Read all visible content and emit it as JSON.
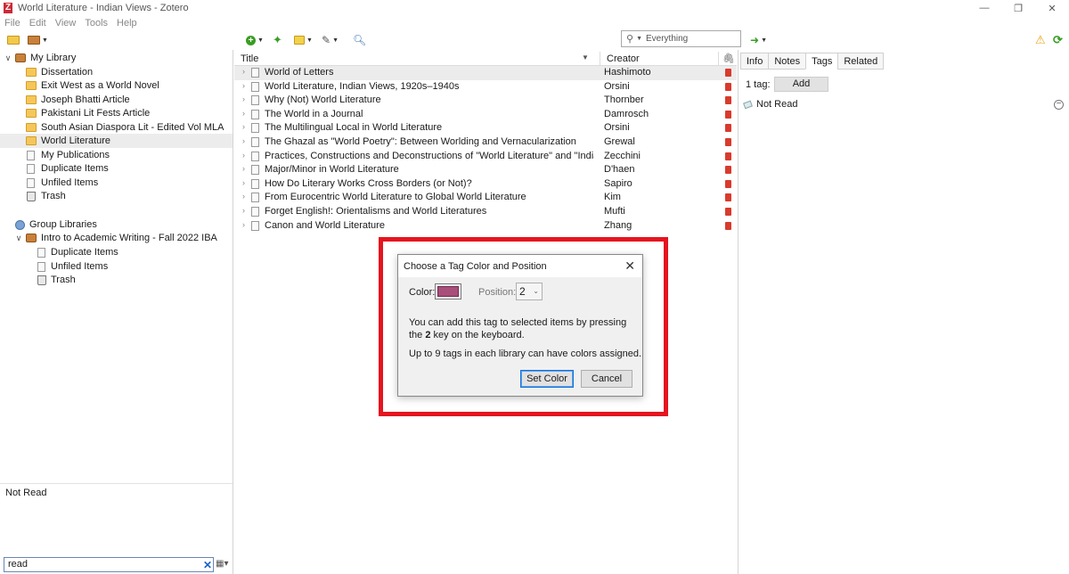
{
  "app": {
    "title": "World Literature - Indian Views - Zotero",
    "logo_letter": "Z"
  },
  "window_controls": {
    "minimize": "—",
    "maximize": "❐",
    "close": "✕"
  },
  "menu": [
    "File",
    "Edit",
    "View",
    "Tools",
    "Help"
  ],
  "toolbar": {
    "search_placeholder": "Everything",
    "warning_icon": "⚠",
    "sync_icon": "⟳",
    "arrow_icon": "➜"
  },
  "collections": {
    "my_library": "My Library",
    "items": [
      "Dissertation",
      "Exit West as a World Novel",
      "Joseph Bhatti Article",
      "Pakistani Lit Fests Article",
      "South Asian Diaspora Lit - Edited Vol MLA",
      "World Literature",
      "My Publications",
      "Duplicate Items",
      "Unfiled Items",
      "Trash"
    ],
    "group_libraries": "Group Libraries",
    "group": "Intro to Academic Writing - Fall 2022 IBA",
    "group_items": [
      "Duplicate Items",
      "Unfiled Items",
      "Trash"
    ]
  },
  "tag_selector": {
    "tag": "Not Read",
    "filter_value": "read"
  },
  "items": {
    "headers": {
      "title": "Title",
      "creator": "Creator"
    },
    "rows": [
      {
        "title": "World of Letters",
        "creator": "Hashimoto"
      },
      {
        "title": "World Literature, Indian Views, 1920s–1940s",
        "creator": "Orsini"
      },
      {
        "title": "Why (Not) World Literature",
        "creator": "Thornber"
      },
      {
        "title": "The World in a Journal",
        "creator": "Damrosch"
      },
      {
        "title": "The Multilingual Local in World Literature",
        "creator": "Orsini"
      },
      {
        "title": "The Ghazal as \"World Poetry\": Between Worlding and Vernacularization",
        "creator": "Grewal"
      },
      {
        "title": "Practices, Constructions and Deconstructions of \"World Literature\" and \"Indian Literature...",
        "creator": "Zecchini"
      },
      {
        "title": "Major/Minor in World Literature",
        "creator": "D'haen"
      },
      {
        "title": "How Do Literary Works Cross Borders (or Not)?",
        "creator": "Sapiro"
      },
      {
        "title": "From Eurocentric World Literature to Global World Literature",
        "creator": "Kim"
      },
      {
        "title": "Forget English!: Orientalisms and World Literatures",
        "creator": "Mufti"
      },
      {
        "title": "Canon and World Literature",
        "creator": "Zhang"
      }
    ]
  },
  "item_pane": {
    "tabs": [
      "Info",
      "Notes",
      "Tags",
      "Related"
    ],
    "active_tab": "Tags",
    "tag_count": "1 tag:",
    "add_label": "Add",
    "tags": [
      "Not Read"
    ]
  },
  "dialog": {
    "title": "Choose a Tag Color and Position",
    "color_label": "Color:",
    "color_value": "#a84f7a",
    "position_label": "Position:",
    "position_value": "2",
    "message_part1": "You can add this tag to selected items by pressing the",
    "message_key": "2",
    "message_part2": "key on the keyboard.",
    "message2": "Up to 9 tags in each library can have colors assigned.",
    "set_color": "Set Color",
    "cancel": "Cancel"
  },
  "colors": {
    "highlight": "#e5141f",
    "selected_row": "#ececec",
    "tag_color": "#a84f7a"
  }
}
